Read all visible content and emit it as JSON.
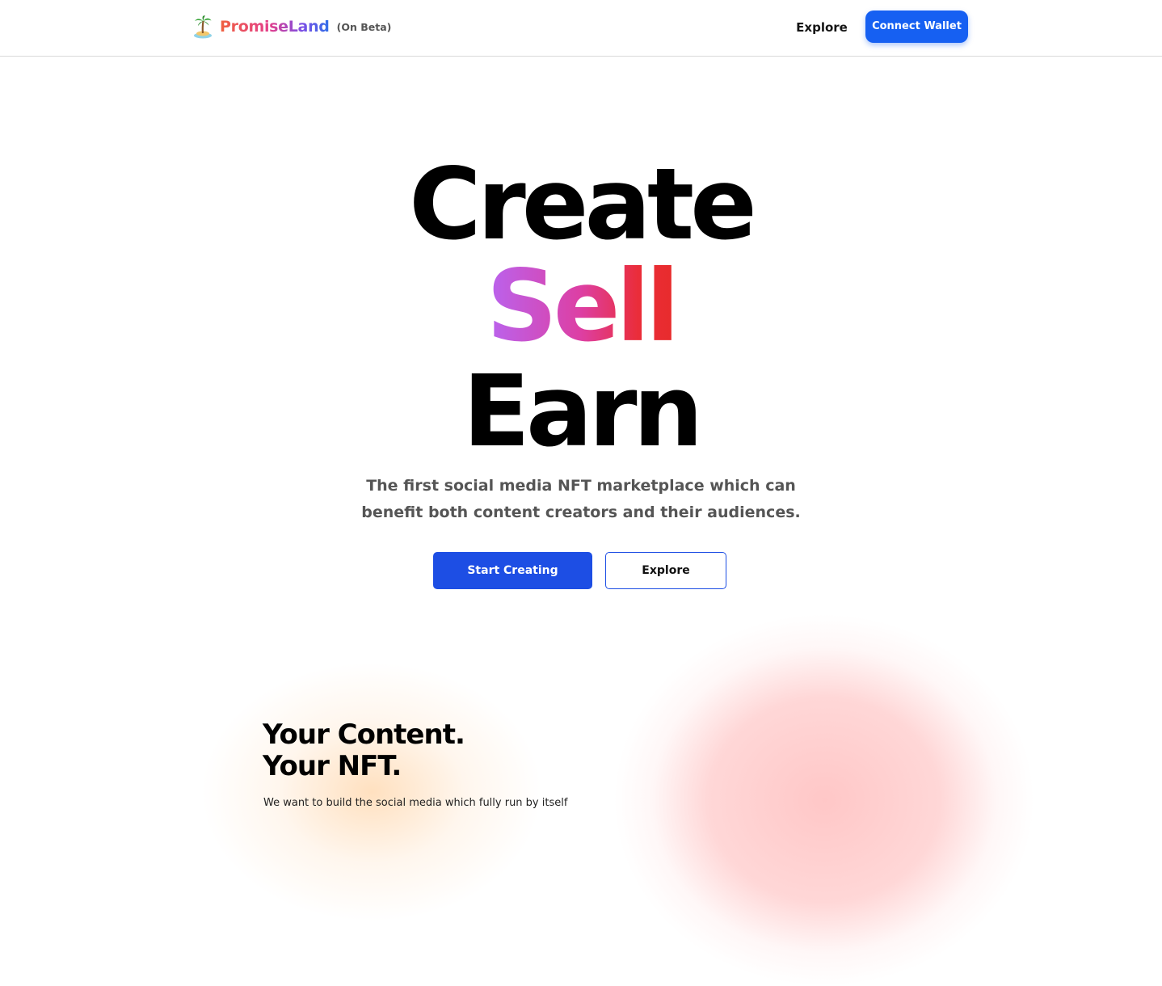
{
  "navbar": {
    "brand": {
      "icon": "palm-island-icon",
      "name": "PromiseLand",
      "beta_label": "(On Beta)"
    },
    "explore_label": "Explore",
    "connect_wallet_label": "Connect Wallet"
  },
  "hero": {
    "words": [
      "Create",
      "Sell",
      "Earn"
    ],
    "subtitle_line1": "The first social media NFT marketplace which can",
    "subtitle_line2": "benefit both content creators and their audiences.",
    "start_creating_label": "Start Creating",
    "explore_label": "Explore"
  },
  "section": {
    "title_line1": "Your Content.",
    "title_line2": "Your NFT.",
    "description": "We want to build the social media which fully run by itself"
  },
  "colors": {
    "primary_blue": "#1660f2",
    "button_blue": "#1d4ee4",
    "sell_gradient": [
      "#b964f0",
      "#dd3fa3",
      "#ea2d3a"
    ],
    "brand_gradient": [
      "#f0613f",
      "#e43f8b",
      "#7b4fe6",
      "#2f6fe8"
    ]
  }
}
